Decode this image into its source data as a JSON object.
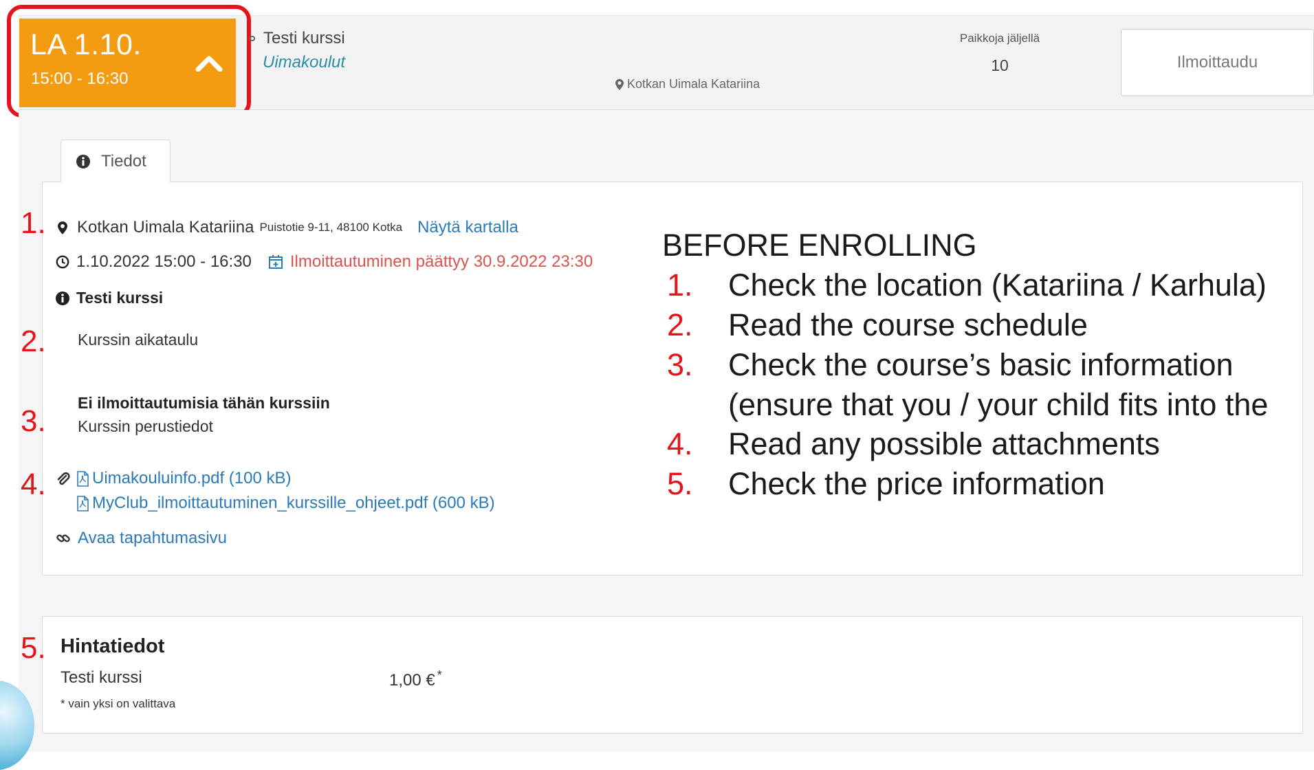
{
  "header": {
    "date_day": "LA 1.10.",
    "date_time": "15:00 - 16:30",
    "course_title": "Testi kurssi",
    "course_category": "Uimakoulut",
    "location": "Kotkan Uimala Katariina",
    "spots_label": "Paikkoja jäljellä",
    "spots_value": "10",
    "enroll_label": "Ilmoittaudu"
  },
  "tabs": [
    {
      "label": "Tiedot",
      "icon": "info-circle-icon"
    }
  ],
  "info": {
    "location_name": "Kotkan Uimala Katariina",
    "location_address": "Puistotie 9-11, 48100 Kotka",
    "map_link": "Näytä kartalla",
    "event_datetime": "1.10.2022 15:00 - 16:30",
    "deadline": "Ilmoittautuminen päättyy 30.9.2022 23:30",
    "title": "Testi kurssi",
    "schedule": "Kurssin aikataulu",
    "no_enrollments": "Ei ilmoittautumisia tähän kurssiin",
    "basic_info": "Kurssin perustiedot",
    "attachments": [
      "Uimakouluinfo.pdf (100 kB)",
      "MyClub_ilmoittautuminen_kurssille_ohjeet.pdf (600 kB)"
    ],
    "event_page_link": "Avaa tapahtumasivu"
  },
  "price": {
    "heading": "Hintatiedot",
    "item_name": "Testi kurssi",
    "item_price": "1,00 €",
    "asterisk": "*",
    "note": "* vain yksi on valittava"
  },
  "markers": [
    "1.",
    "2.",
    "3.",
    "4.",
    "5."
  ],
  "instructions": {
    "heading": "BEFORE ENROLLING",
    "items": [
      {
        "num": "1.",
        "text": "Check the location (Katariina / Karhula)"
      },
      {
        "num": "2.",
        "text": "Read the course schedule"
      },
      {
        "num": "3.",
        "text": "Check the course’s basic information"
      },
      {
        "num": "",
        "text": "(ensure that you / your child fits into the"
      },
      {
        "num": "4.",
        "text": "Read any possible attachments"
      },
      {
        "num": "5.",
        "text": "Check the price information"
      }
    ]
  },
  "colors": {
    "accent_orange": "#f39c12",
    "highlight_red": "#e3141c",
    "link_blue": "#2a7ab8",
    "deadline_red": "#d9534f"
  }
}
